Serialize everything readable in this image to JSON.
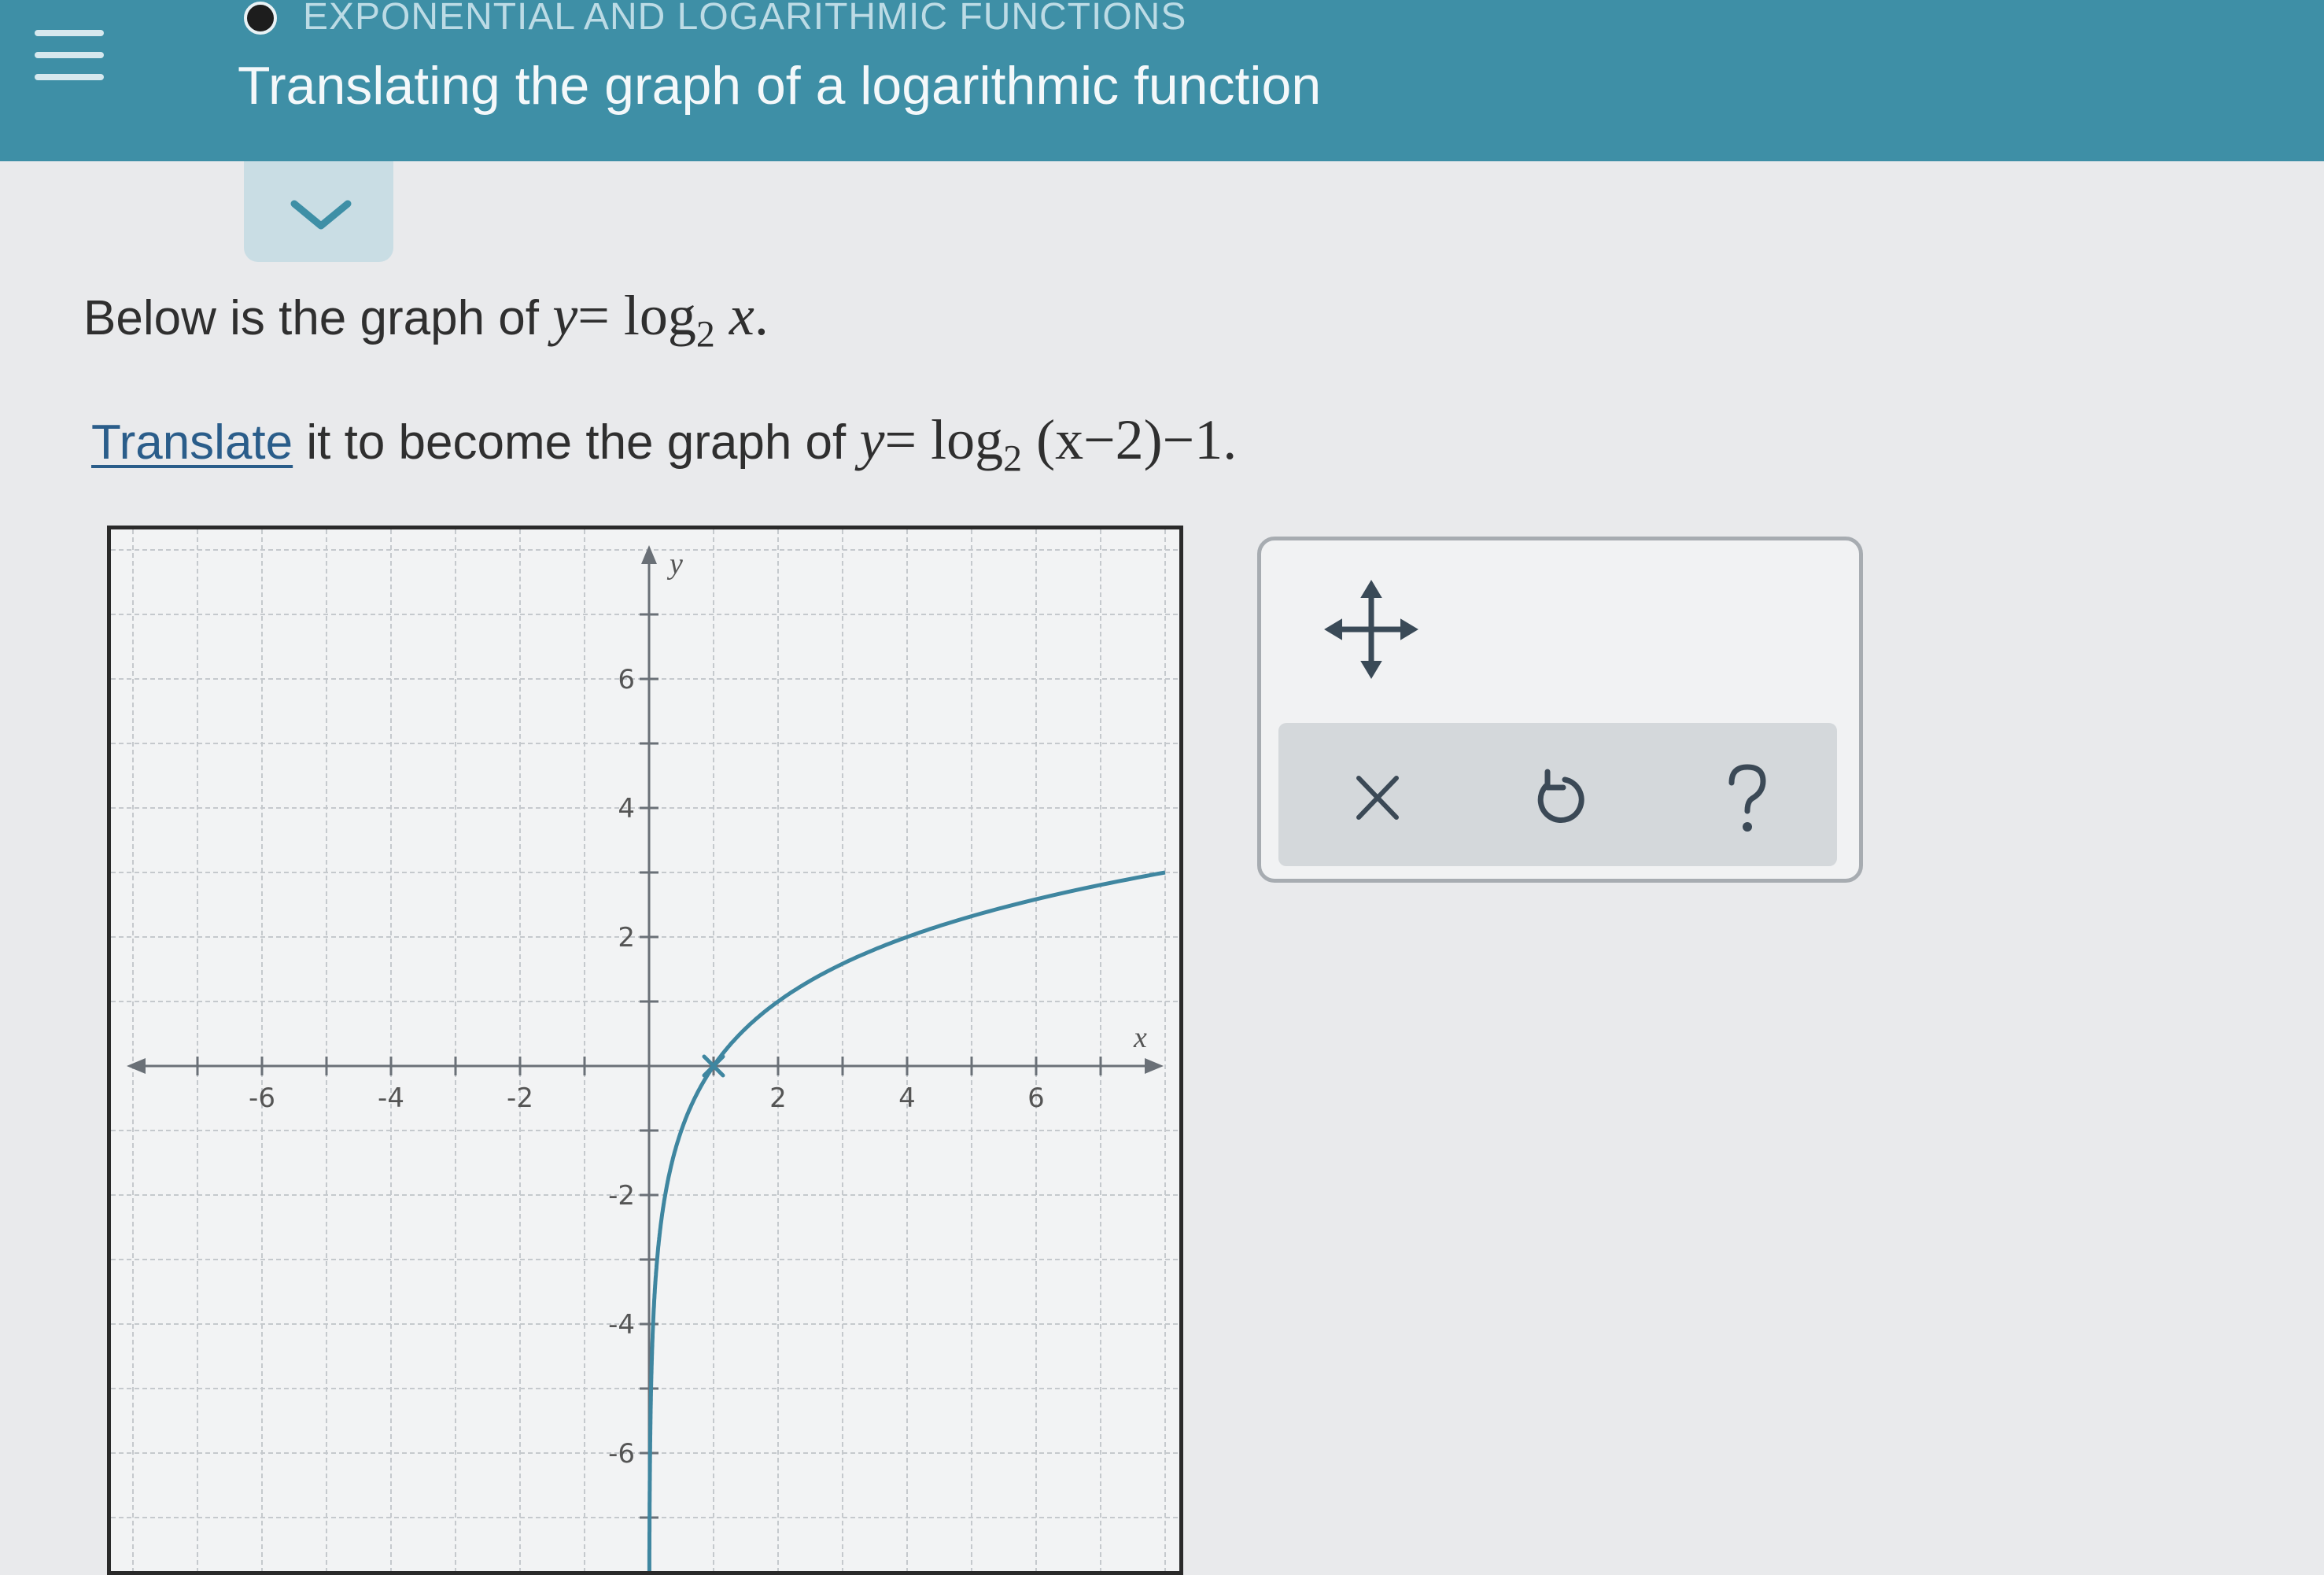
{
  "header": {
    "topic": "EXPONENTIAL AND LOGARITHMIC FUNCTIONS",
    "title": "Translating the graph of a logarithmic function"
  },
  "prompt": {
    "line1_text": "Below is the graph of",
    "line1_math": {
      "y": "y",
      "eq": "=",
      "log": "log",
      "base": "2",
      "arg": "x",
      "end": "."
    },
    "line2_link": "Translate",
    "line2_text": " it to become the graph of",
    "line2_math": {
      "y": "y",
      "eq": "=",
      "log": "log",
      "base": "2",
      "arg": "(x−2)",
      "shift": "−1",
      "end": "."
    }
  },
  "graph": {
    "x_axis_label": "x",
    "y_axis_label": "y",
    "x_ticks": [
      "-6",
      "-4",
      "-2",
      "2",
      "4",
      "6"
    ],
    "y_ticks": [
      "6",
      "4",
      "2",
      "-2",
      "-4",
      "-6"
    ],
    "x_range": [
      -8,
      8
    ],
    "y_range": [
      -8,
      8
    ],
    "grid": true,
    "curve": "y = log2(x)",
    "marked_point": [
      1,
      0
    ],
    "curve_color": "#3f86a0"
  },
  "tools": {
    "move_icon": "move-arrows-icon",
    "clear_icon": "close-icon",
    "undo_icon": "undo-icon",
    "help_icon": "help-icon"
  }
}
